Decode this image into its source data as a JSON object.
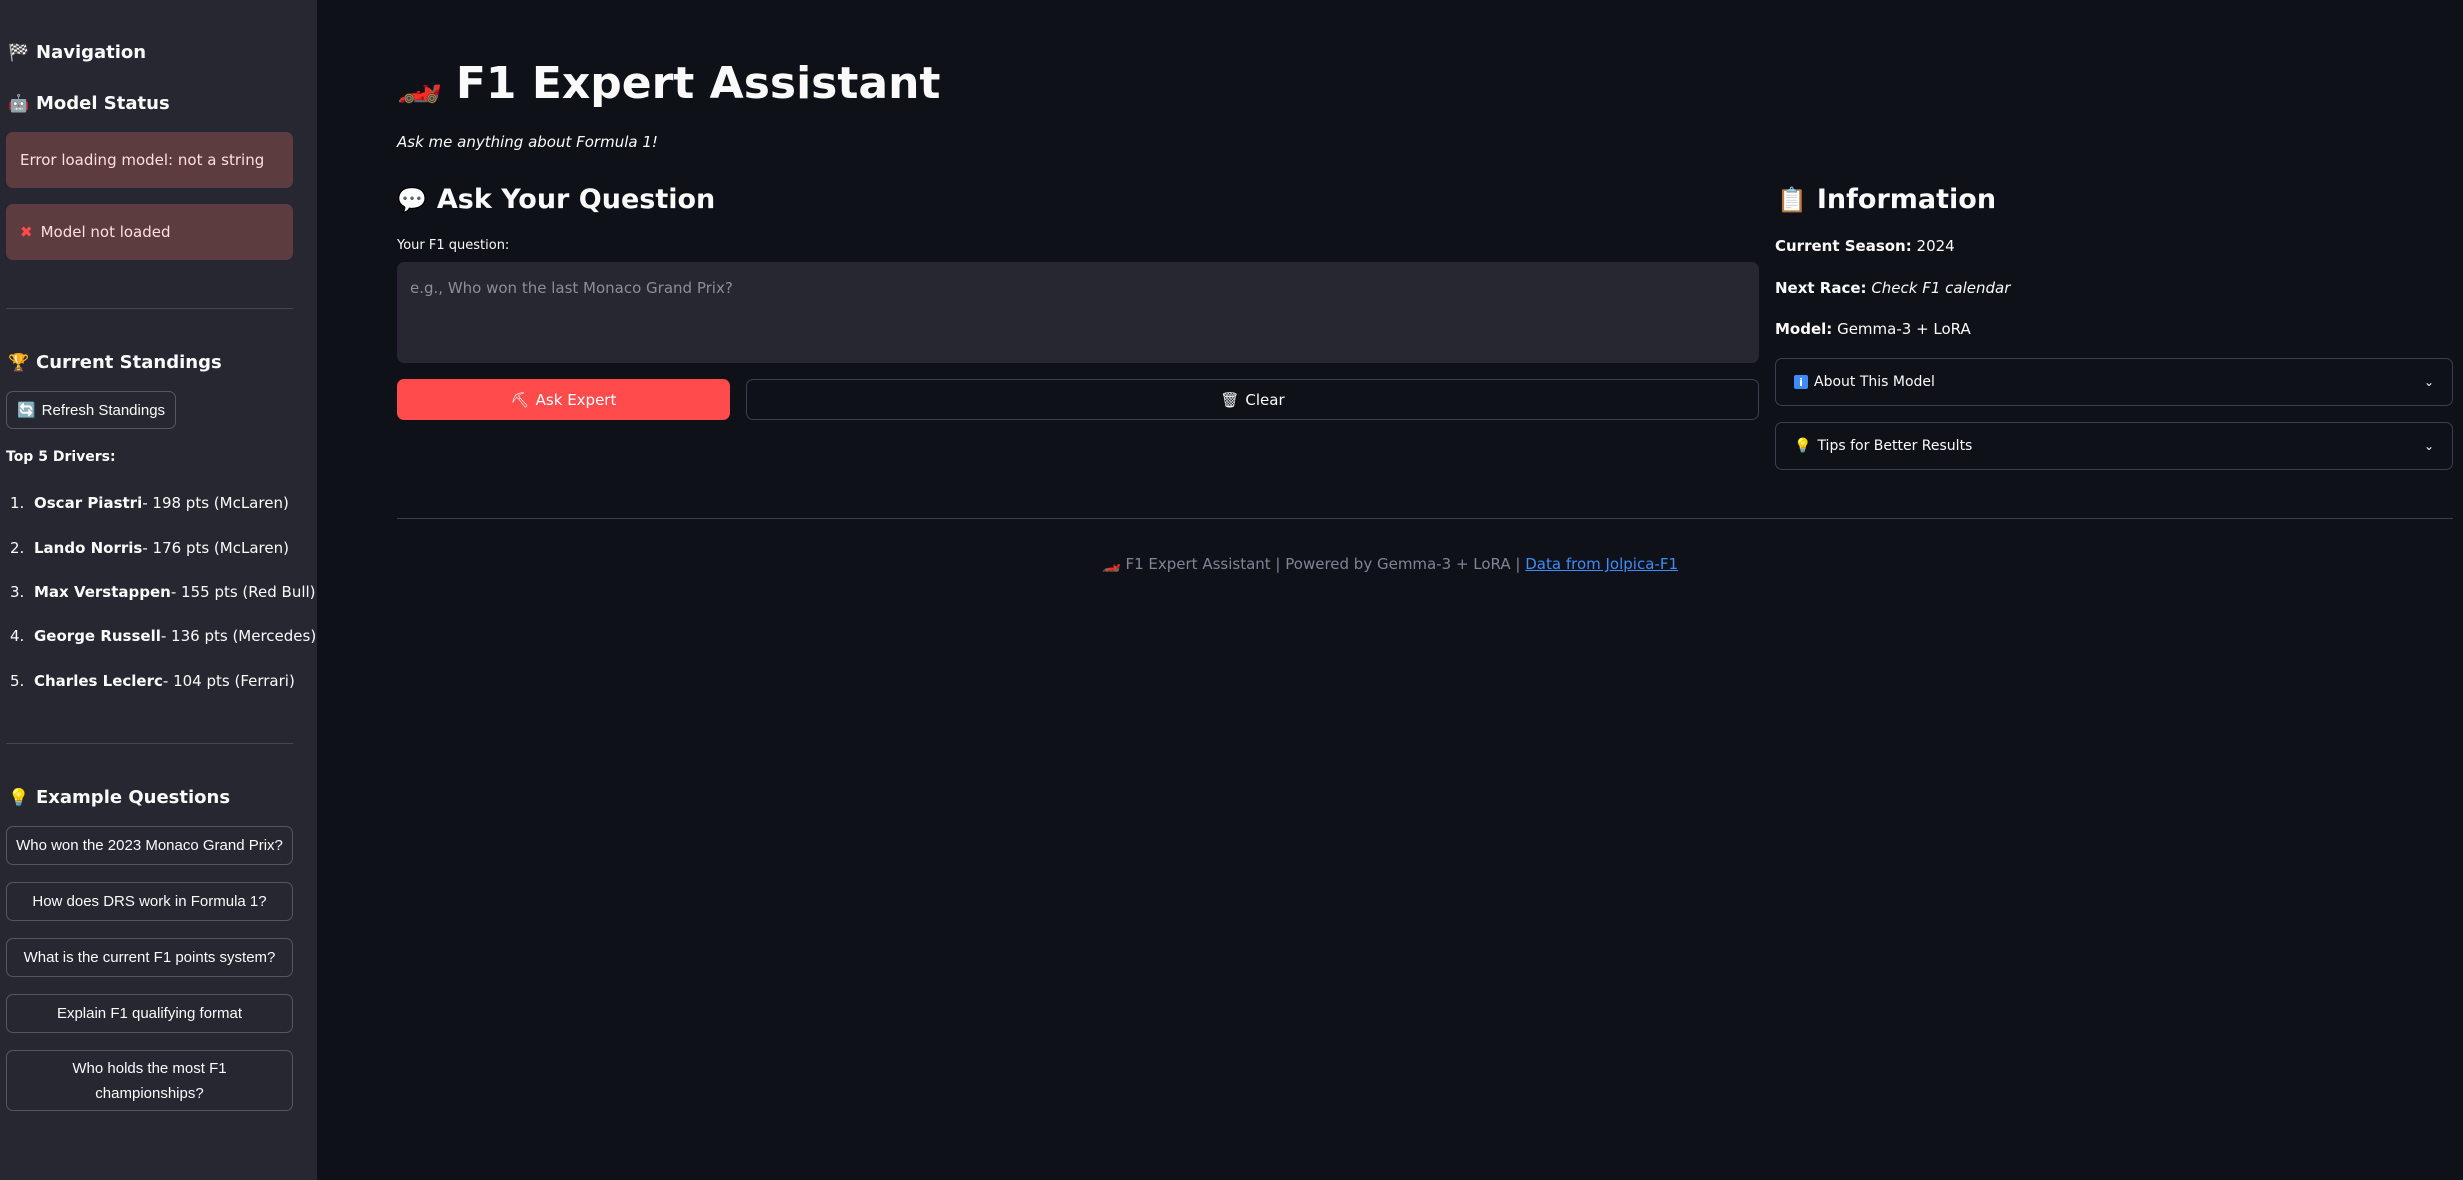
{
  "sidebar": {
    "navigation_title": "Navigation",
    "model_status_title": "Model Status",
    "error_message": "Error loading model: not a string",
    "not_loaded_message": "Model not loaded",
    "standings_title": "Current Standings",
    "refresh_button": "Refresh Standings",
    "top_drivers_label": "Top 5 Drivers:",
    "drivers": [
      {
        "num": "1.",
        "name": "Oscar Piastri",
        "detail": " - 198 pts (McLaren)"
      },
      {
        "num": "2.",
        "name": "Lando Norris",
        "detail": " - 176 pts (McLaren)"
      },
      {
        "num": "3.",
        "name": "Max Verstappen",
        "detail": " - 155 pts (Red Bull)"
      },
      {
        "num": "4.",
        "name": "George Russell",
        "detail": " - 136 pts (Mercedes)"
      },
      {
        "num": "5.",
        "name": "Charles Leclerc",
        "detail": " - 104 pts (Ferrari)"
      }
    ],
    "examples_title": "Example Questions",
    "examples": [
      "Who won the 2023 Monaco Grand Prix?",
      "How does DRS work in Formula 1?",
      "What is the current F1 points system?",
      "Explain F1 qualifying format",
      "Who holds the most F1 championships?"
    ]
  },
  "main": {
    "title": "F1 Expert Assistant",
    "subtitle": "Ask me anything about Formula 1!",
    "ask_title": "Ask Your Question",
    "question_label": "Your F1 question:",
    "question_placeholder": "e.g., Who won the last Monaco Grand Prix?",
    "ask_button": "Ask Expert",
    "clear_button": "Clear",
    "info_title": "Information",
    "season_label": "Current Season:",
    "season_value": "2024",
    "next_race_label": "Next Race:",
    "next_race_value": "Check F1 calendar",
    "model_label": "Model:",
    "model_value": "Gemma-3 + LoRA",
    "about_expander": "About This Model",
    "tips_expander": "Tips for Better Results",
    "footer_text": "F1 Expert Assistant | Powered by Gemma-3 + LoRA |",
    "footer_link": "Data from Jolpica-F1"
  },
  "icons": {
    "navigation": "checkered-flag-icon",
    "model_status": "robot-icon",
    "not_loaded": "cross-mark-icon",
    "standings": "trophy-icon",
    "refresh": "refresh-icon",
    "examples": "lightbulb-icon",
    "title": "race-car-icon",
    "ask": "speech-bubble-icon",
    "ask_button": "pick-icon",
    "clear_button": "wastebasket-icon",
    "info": "clipboard-icon",
    "about": "info-icon",
    "tips": "lightbulb-icon"
  },
  "colors": {
    "background": "#0e1117",
    "sidebar": "#262730",
    "primary": "#ff4b4b",
    "error_bg": "#5d3c40",
    "link": "#3d8bfd"
  }
}
